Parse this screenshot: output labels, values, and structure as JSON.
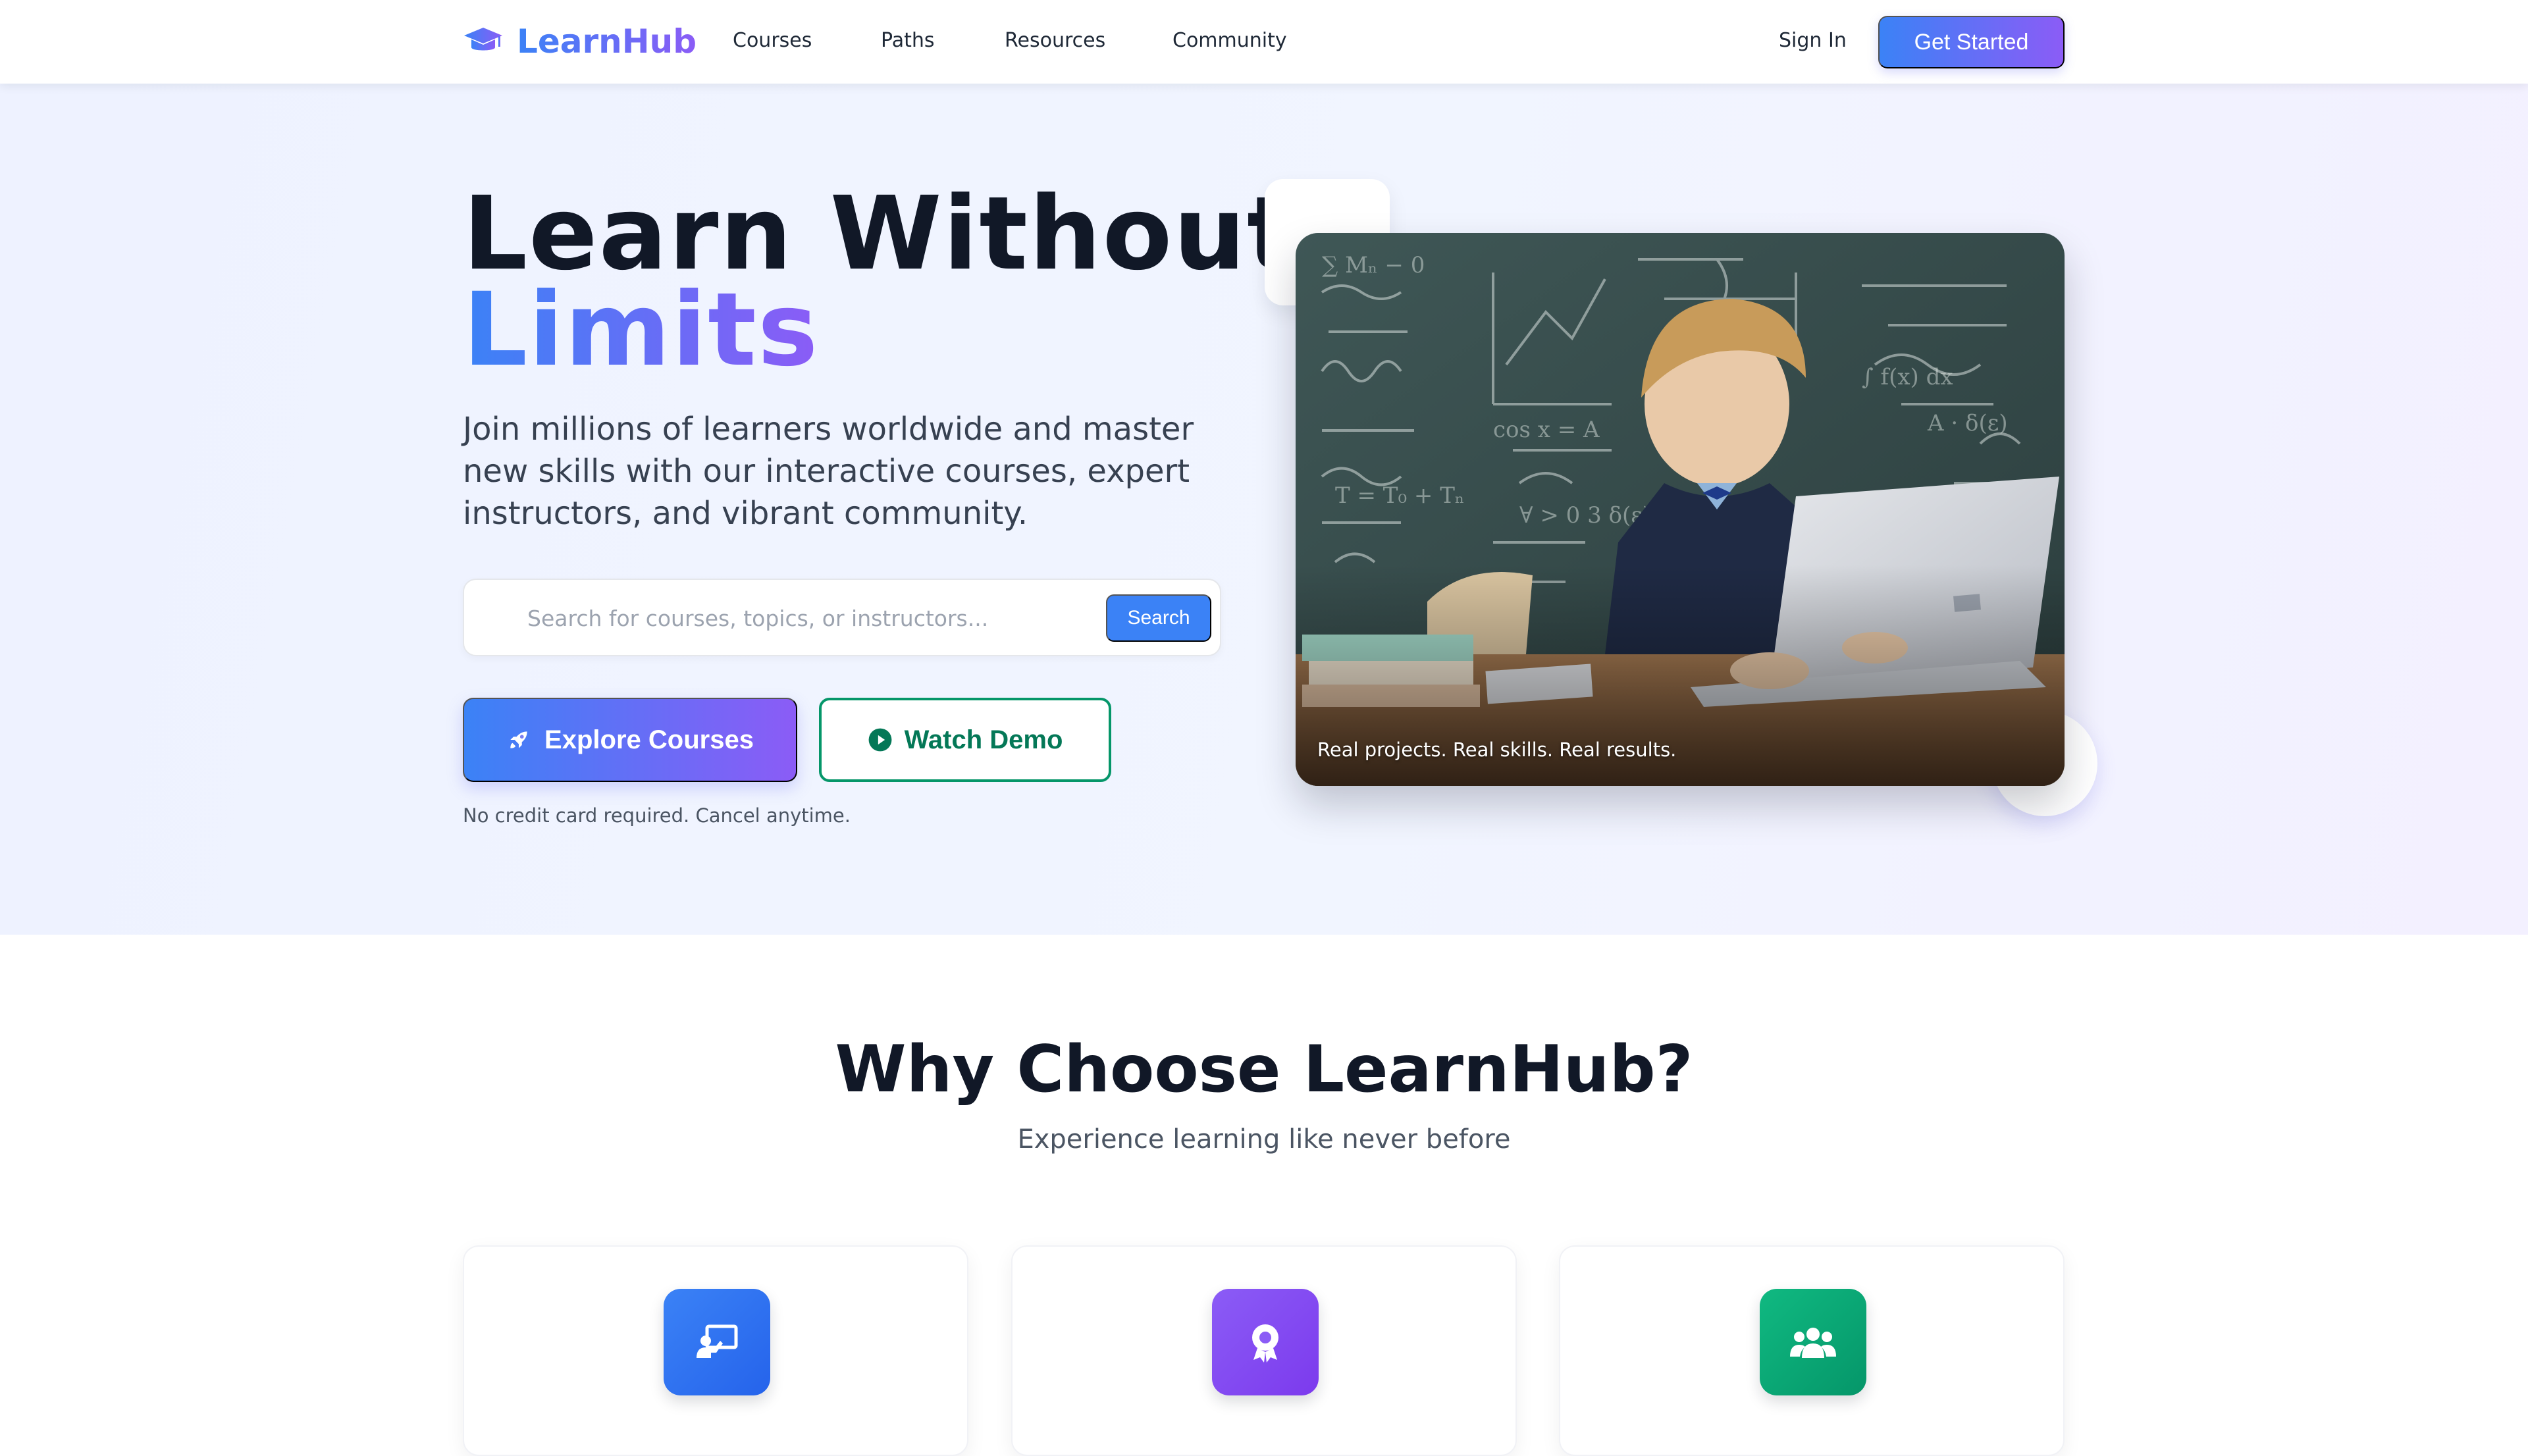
{
  "brand": {
    "name": "LearnHub",
    "icon": "graduation-cap-icon"
  },
  "nav": {
    "links": [
      "Courses",
      "Paths",
      "Resources",
      "Community"
    ],
    "sign_in": "Sign In",
    "get_started": "Get Started"
  },
  "hero": {
    "title_line1": "Learn Without",
    "title_line2": "Limits",
    "subtitle": "Join millions of learners worldwide and master new skills with our interactive courses, expert instructors, and vibrant community.",
    "search_placeholder": "Search for courses, topics, or instructors...",
    "search_button": "Search",
    "explore_button": "Explore Courses",
    "demo_button": "Watch Demo",
    "note": "No credit card required. Cancel anytime.",
    "image_caption": "Real projects. Real skills. Real results."
  },
  "why": {
    "title": "Why Choose LearnHub?",
    "subtitle": "Experience learning like never before",
    "cards": [
      {
        "icon": "chalkboard-teacher-icon",
        "color": "#2563eb"
      },
      {
        "icon": "certificate-award-icon",
        "color": "#7c3aed"
      },
      {
        "icon": "users-group-icon",
        "color": "#059669"
      }
    ]
  },
  "colors": {
    "primary": "#3b82f6",
    "accent": "#8b5cf6",
    "green": "#059669"
  }
}
